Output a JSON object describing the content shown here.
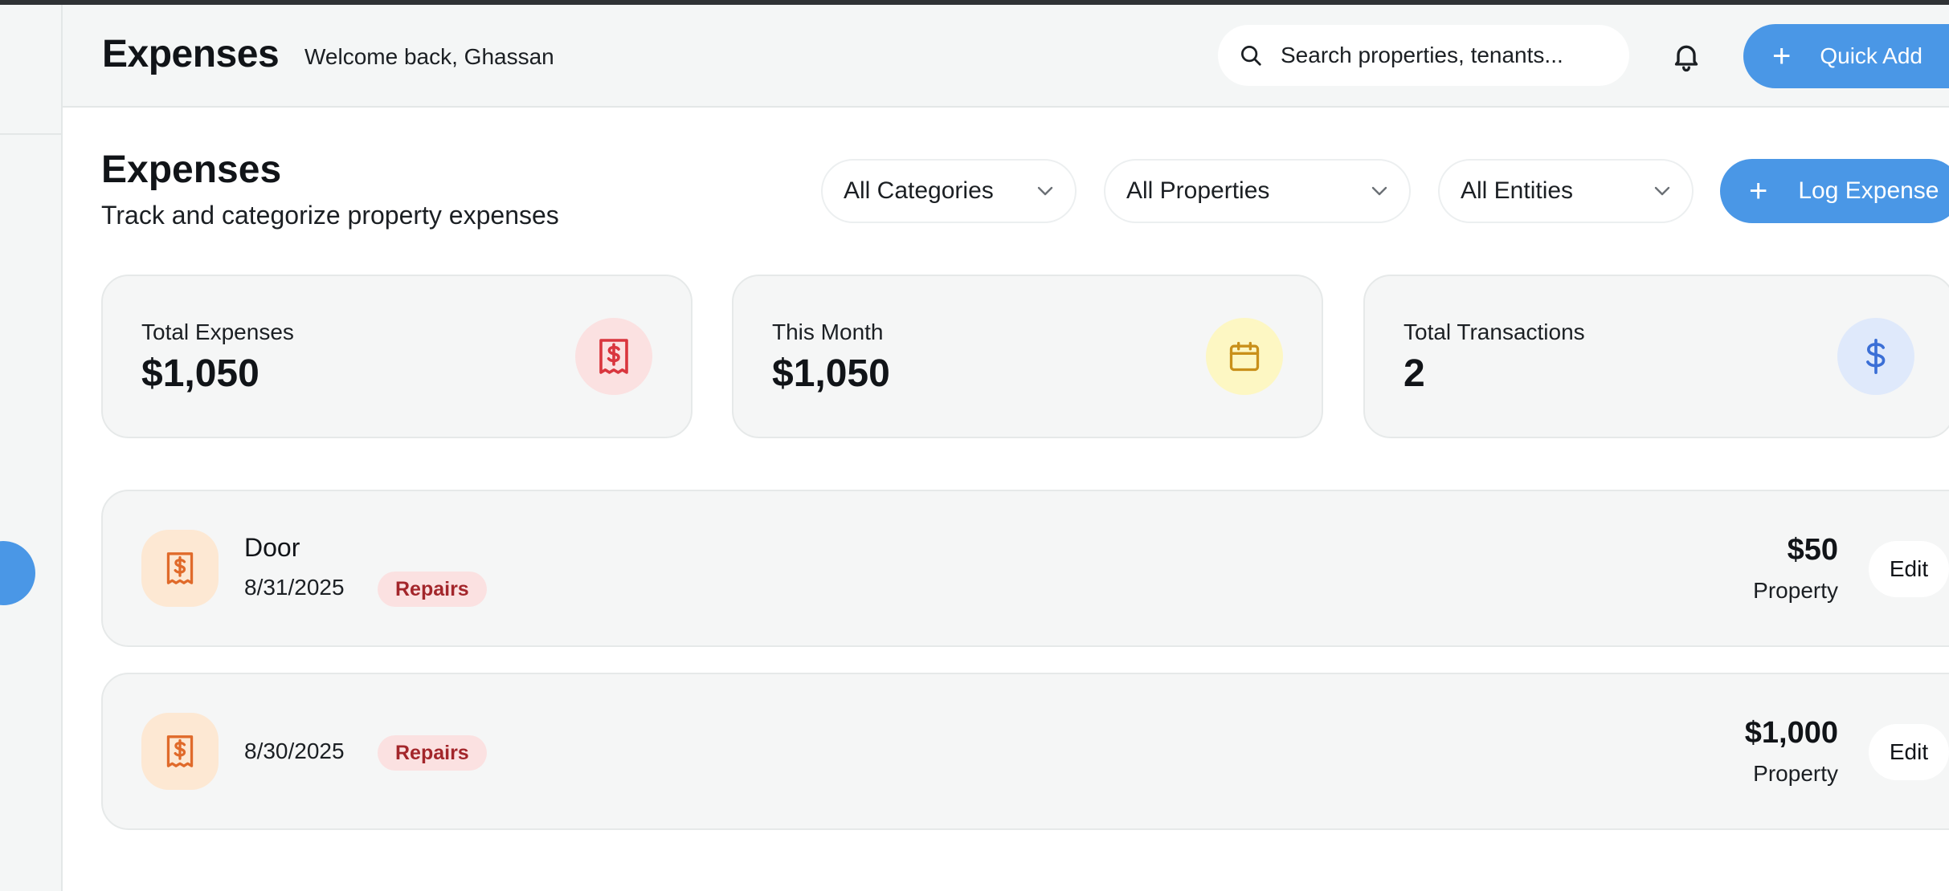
{
  "header": {
    "title": "Expenses",
    "welcome": "Welcome back, Ghassan",
    "search_placeholder": "Search properties, tenants...",
    "quick_add_label": "Quick Add"
  },
  "page": {
    "title": "Expenses",
    "subtitle": "Track and categorize property expenses"
  },
  "filters": {
    "category": "All Categories",
    "property": "All Properties",
    "entity": "All Entities"
  },
  "actions": {
    "log_expense_label": "Log Expense"
  },
  "stats": [
    {
      "label": "Total Expenses",
      "value": "$1,050",
      "icon": "receipt-icon",
      "color": "#d9363e",
      "bg": "#fbe1e1"
    },
    {
      "label": "This Month",
      "value": "$1,050",
      "icon": "calendar-icon",
      "color": "#c9901a",
      "bg": "#fdf7c3"
    },
    {
      "label": "Total Transactions",
      "value": "2",
      "icon": "dollar-icon",
      "color": "#3b6fd6",
      "bg": "#dfe9fb"
    }
  ],
  "expenses": [
    {
      "name": "Door",
      "date": "8/31/2025",
      "category": "Repairs",
      "amount": "$50",
      "type": "Property",
      "edit_label": "Edit"
    },
    {
      "name": "",
      "date": "8/30/2025",
      "category": "Repairs",
      "amount": "$1,000",
      "type": "Property",
      "edit_label": "Edit"
    }
  ],
  "colors": {
    "accent": "#4a97e6",
    "receipt_orange": "#e06a2a"
  }
}
